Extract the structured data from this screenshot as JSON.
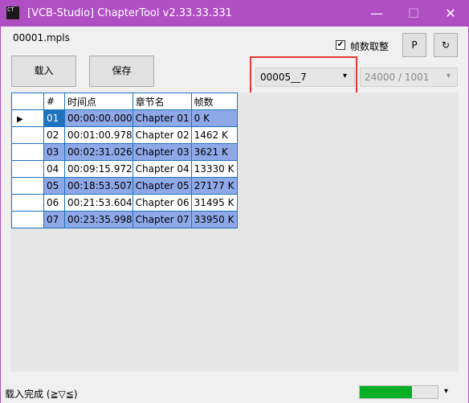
{
  "window": {
    "icon_text": "CT",
    "title": "[VCB-Studio] ChapterTool v2.33.33.331",
    "minimize": "—",
    "maximize": "☐",
    "close": "✕"
  },
  "file_label": "00001.mpls",
  "toolbar": {
    "load_label": "载入",
    "save_label": "保存",
    "round_frames_label": "帧数取整",
    "round_frames_checked": true,
    "p_button_label": "P",
    "refresh_icon": "↻"
  },
  "chapter_select": {
    "value": "00005__7",
    "arrow": "▾"
  },
  "framerate_select": {
    "value": "24000 / 1001",
    "arrow": "▾"
  },
  "table": {
    "row_indicator": "▶",
    "headers": [
      "#",
      "时间点",
      "章节名",
      "帧数"
    ],
    "rows": [
      [
        "01",
        "00:00:00.000",
        "Chapter 01",
        "0 K"
      ],
      [
        "02",
        "00:01:00.978",
        "Chapter 02",
        "1462 K"
      ],
      [
        "03",
        "00:02:31.026",
        "Chapter 03",
        "3621 K"
      ],
      [
        "04",
        "00:09:15.972",
        "Chapter 04",
        "13330 K"
      ],
      [
        "05",
        "00:18:53.507",
        "Chapter 05",
        "27177 K"
      ],
      [
        "06",
        "00:21:53.604",
        "Chapter 06",
        "31495 K"
      ],
      [
        "07",
        "00:23:35.998",
        "Chapter 07",
        "33950 K"
      ]
    ]
  },
  "status": {
    "text": "载入完成 (≧▽≦)",
    "progress": 0.67,
    "menu_arrow": "▾"
  },
  "colors": {
    "titlebar": "#b04fc4",
    "row_highlight": "#8fa8e8",
    "selection": "#1e73be",
    "progress_fill": "#06b025",
    "callout_border": "#e53935"
  }
}
